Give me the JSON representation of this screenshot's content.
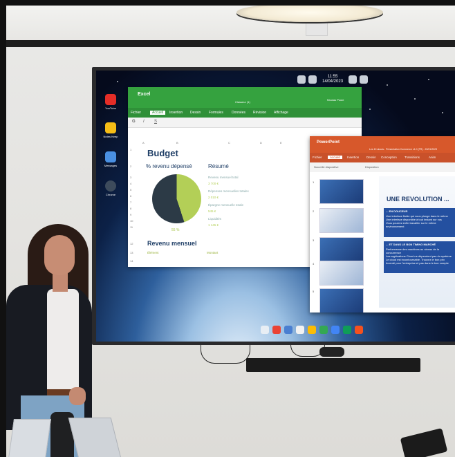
{
  "colors": {
    "excel_green": "#35a23f",
    "powerpoint_orange": "#d7582b",
    "chart_lime": "#b3cf57",
    "chart_dark": "#2c3a46",
    "title_navy": "#1f3e66"
  },
  "tv": {
    "clock_time": "11:55",
    "clock_date": "14/04/2023",
    "sidebar_apps": [
      {
        "label": "YouTube",
        "icon": "youtube-icon",
        "color": "#e52d27"
      },
      {
        "label": "Notes Keep",
        "icon": "keep-icon",
        "color": "#f6bd16"
      },
      {
        "label": "Messages",
        "icon": "messages-icon",
        "color": "#4a90e2"
      },
      {
        "label": "Chrome",
        "icon": "globe-icon",
        "color": "#3d4b5c"
      }
    ],
    "dock_icons": [
      "pinwheel-icon",
      "gmail-icon",
      "files-icon",
      "photos-icon",
      "drive-icon",
      "chrome-icon",
      "docs-icon",
      "sheets-icon",
      "slides-icon"
    ]
  },
  "excel": {
    "app_title": "Excel",
    "doc_name": "Classeur (1)",
    "user": "Nicolas Poule",
    "ribbon_tabs": [
      "Fichier",
      "Accueil",
      "Insertion",
      "Dessin",
      "Formules",
      "Données",
      "Révision",
      "Affichage"
    ],
    "tool_glyphs": [
      "G",
      "I",
      "S"
    ],
    "sheet_title": "Budget",
    "pct_label": "% revenu dépensé",
    "resume_label": "Résumé",
    "resume_lines": [
      "Revenu mensuel total",
      "Dépenses mensuelles totales",
      "Épargne mensuelle totale",
      "Liquidités"
    ],
    "resume_values": [
      "3 700 €",
      "2 010 €",
      "545 €",
      "1 145 €"
    ],
    "pie_pct": "55 %",
    "section_revenu": "Revenu mensuel",
    "revenu_cols": [
      "Élément",
      "Montant"
    ],
    "col_headers": [
      "A",
      "B",
      "C",
      "D",
      "E"
    ],
    "row_headers": [
      "1",
      "2",
      "3",
      "4",
      "5",
      "6",
      "7",
      "8",
      "9",
      "10",
      "11",
      "12",
      "13",
      "14"
    ]
  },
  "chart_data": {
    "type": "pie",
    "title": "% revenu dépensé",
    "categories": [
      "",
      ""
    ],
    "values": [
      45,
      55
    ],
    "data_labels": [
      "55 %"
    ],
    "colors": [
      "#b3cf57",
      "#2c3a46"
    ]
  },
  "powerpoint": {
    "app_title": "PowerPoint",
    "doc_name": "Les 10 atouts - Présentation Commerce v1.0 (FR) - 20/01/2023",
    "ribbon_tabs": [
      "Fichier",
      "Accueil",
      "Insertion",
      "Dessin",
      "Conception",
      "Transitions",
      "Anim"
    ],
    "tools": [
      "Nouvelle diapositive",
      "Disposition"
    ],
    "thumb_numbers": [
      "1",
      "2",
      "3",
      "4",
      "5"
    ],
    "slide_heading": "UNE REVOLUTION ...",
    "slide_box1_title": "... EN DOUCEUR",
    "slide_box1_lines": [
      "Une interface fluide qui vous plonge dans le même",
      "Une interface disponible à tout instant sur vos",
      "Vous pourrez enfin travailler sur le même environnement"
    ],
    "slide_box2_title": "... ET DANS LE BON TIMING MARCHÉ",
    "slide_box2_lines": [
      "Performance des machines au niveau de la concurrence",
      "Les applications Cloud ne dépendent pas du système",
      "Le cloud est incontournable. Trouvez le bon prix",
      "Inventé pour l'entreprise et pas dans le bon compte"
    ]
  }
}
